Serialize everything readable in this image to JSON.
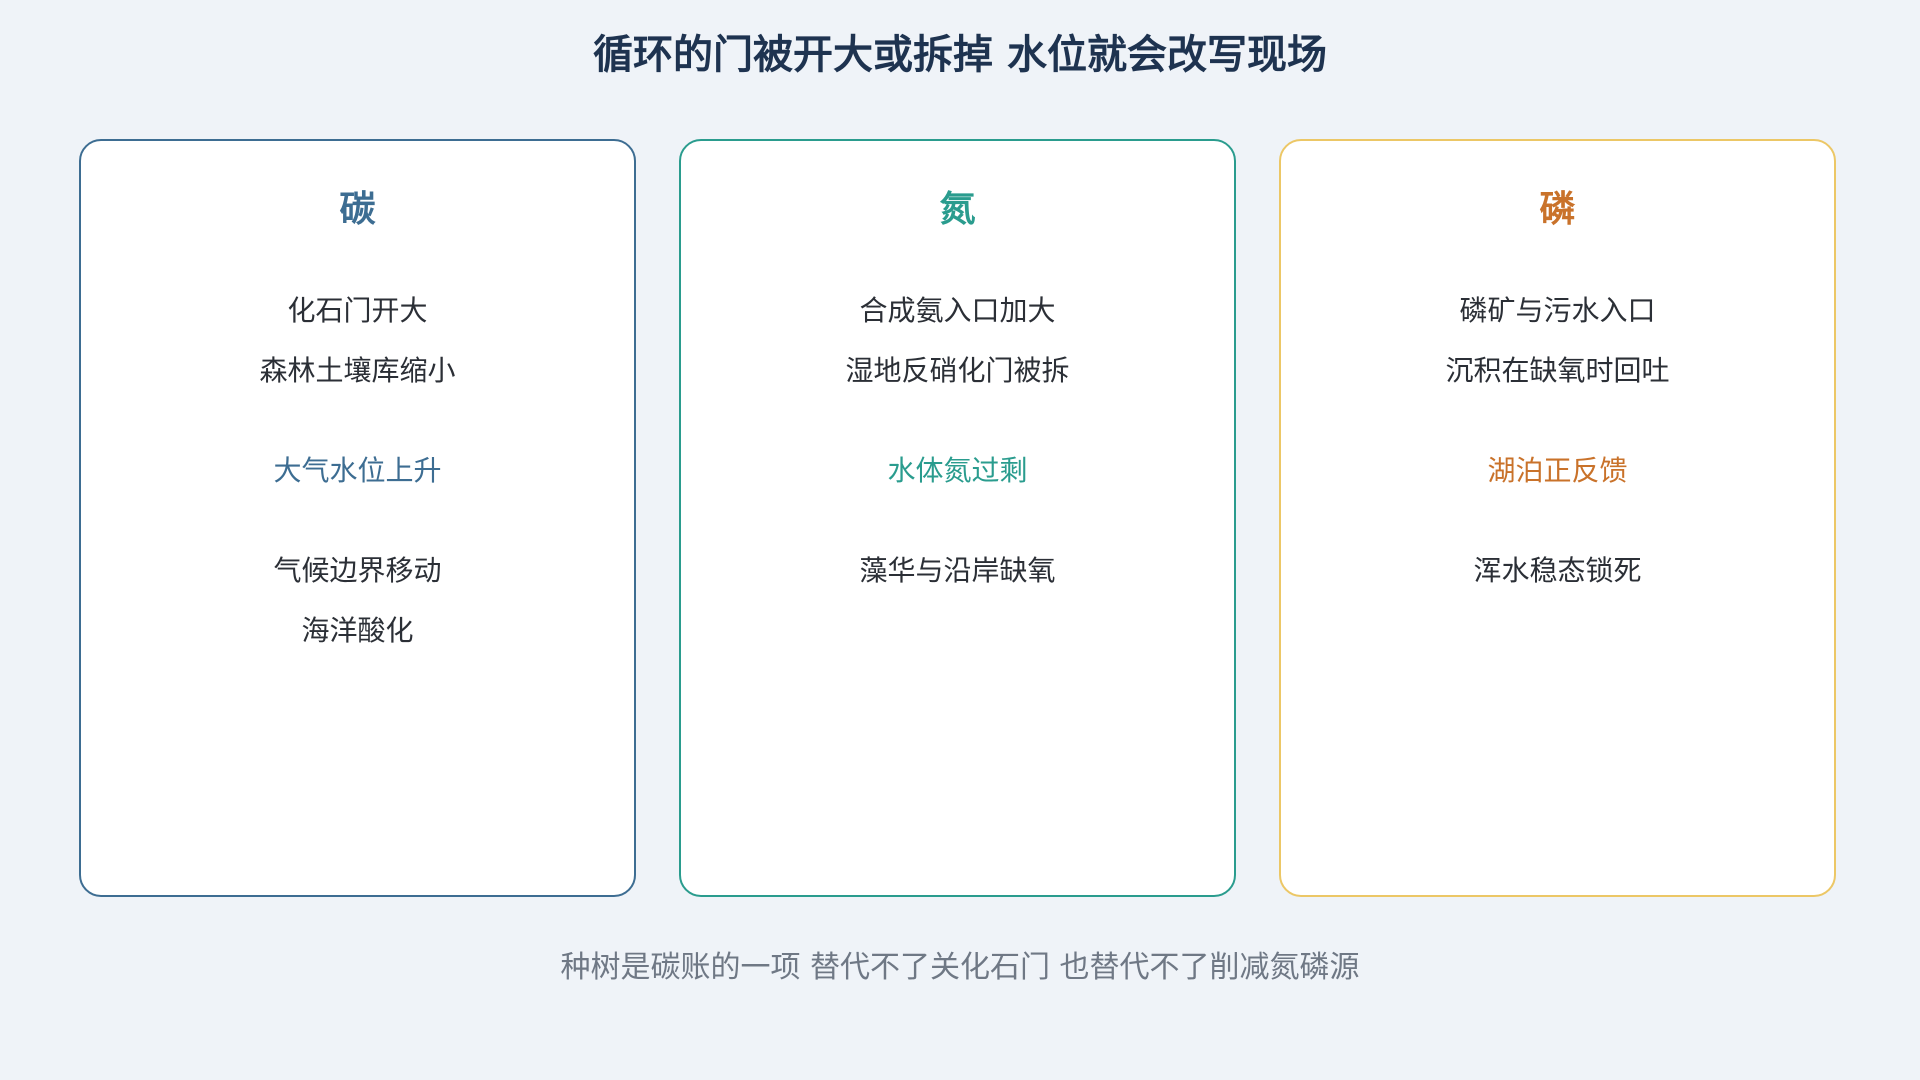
{
  "title": "循环的门被开大或拆掉 水位就会改写现场",
  "colors": {
    "background": "#eff3f8",
    "title": "#1e3350",
    "carbon": "#3d6d92",
    "nitrogen": "#2a9c8e",
    "phosphorus_border": "#ecc766",
    "phosphorus_text": "#c9722a",
    "body_text": "#2b2f36",
    "footer_text": "#6f7885"
  },
  "cards": [
    {
      "name": "碳",
      "causes": [
        "化石门开大",
        "森林土壤库缩小"
      ],
      "state": "大气水位上升",
      "effects": [
        "气候边界移动",
        "海洋酸化"
      ]
    },
    {
      "name": "氮",
      "causes": [
        "合成氨入口加大",
        "湿地反硝化门被拆"
      ],
      "state": "水体氮过剩",
      "effects": [
        "藻华与沿岸缺氧"
      ]
    },
    {
      "name": "磷",
      "causes": [
        "磷矿与污水入口",
        "沉积在缺氧时回吐"
      ],
      "state": "湖泊正反馈",
      "effects": [
        "浑水稳态锁死"
      ]
    }
  ],
  "footer": "种树是碳账的一项 替代不了关化石门 也替代不了削减氮磷源"
}
